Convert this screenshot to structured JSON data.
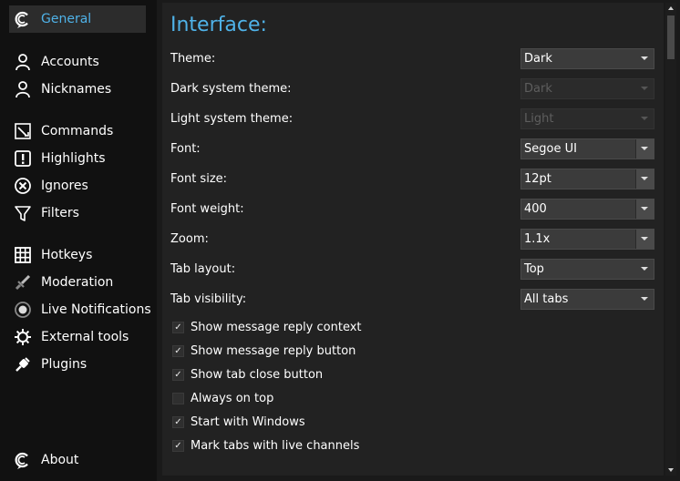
{
  "sidebar": {
    "items": [
      {
        "label": "General",
        "icon": "chatterino-logo-icon",
        "active": true
      },
      {
        "label": "Accounts",
        "icon": "user-icon"
      },
      {
        "label": "Nicknames",
        "icon": "user-icon"
      },
      {
        "label": "Commands",
        "icon": "commands-icon"
      },
      {
        "label": "Highlights",
        "icon": "exclamation-icon"
      },
      {
        "label": "Ignores",
        "icon": "ignore-icon"
      },
      {
        "label": "Filters",
        "icon": "funnel-icon"
      },
      {
        "label": "Hotkeys",
        "icon": "keyboard-grid-icon"
      },
      {
        "label": "Moderation",
        "icon": "sword-icon"
      },
      {
        "label": "Live Notifications",
        "icon": "live-icon"
      },
      {
        "label": "External tools",
        "icon": "gear-icon"
      },
      {
        "label": "Plugins",
        "icon": "plug-icon"
      },
      {
        "label": "About",
        "icon": "chatterino-logo-icon"
      }
    ]
  },
  "page": {
    "title": "Interface:",
    "settings": [
      {
        "label": "Theme:",
        "value": "Dark"
      },
      {
        "label": "Dark system theme:",
        "value": "Dark",
        "disabled": true
      },
      {
        "label": "Light system theme:",
        "value": "Light",
        "disabled": true
      },
      {
        "label": "Font:",
        "value": "Segoe UI"
      },
      {
        "label": "Font size:",
        "value": "12pt"
      },
      {
        "label": "Font weight:",
        "value": "400"
      },
      {
        "label": "Zoom:",
        "value": "1.1x"
      },
      {
        "label": "Tab layout:",
        "value": "Top"
      },
      {
        "label": "Tab visibility:",
        "value": "All tabs"
      }
    ],
    "checkboxes": [
      {
        "label": "Show message reply context",
        "checked": true
      },
      {
        "label": "Show message reply button",
        "checked": true
      },
      {
        "label": "Show tab close button",
        "checked": true
      },
      {
        "label": "Always on top",
        "checked": false
      },
      {
        "label": "Start with Windows",
        "checked": true
      },
      {
        "label": "Mark tabs with live channels",
        "checked": true
      }
    ]
  },
  "check_glyph": "✓",
  "colors": {
    "accent": "#4fb2e8",
    "background": "#1a1a1a",
    "panel": "#222222"
  }
}
